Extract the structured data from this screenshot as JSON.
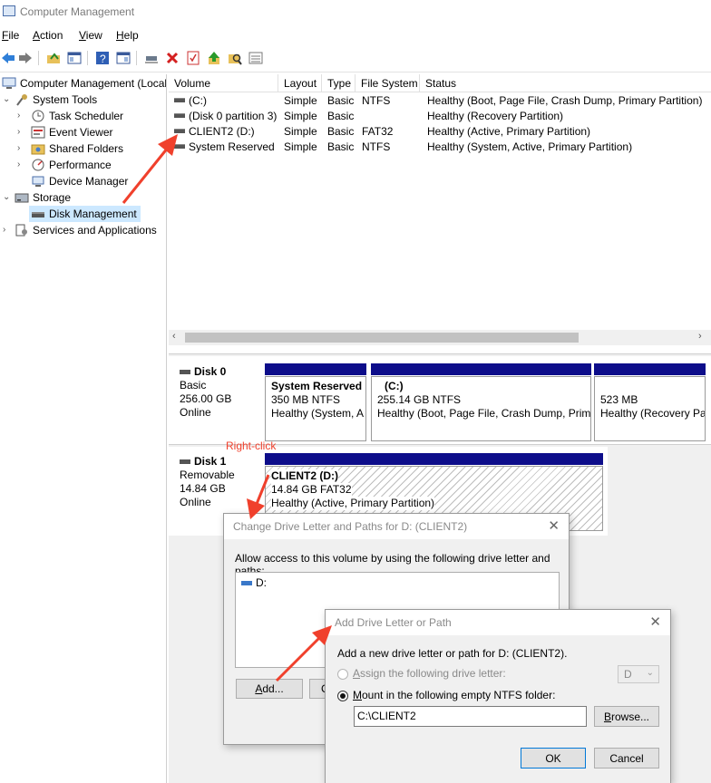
{
  "window": {
    "title": "Computer Management"
  },
  "menu": [
    {
      "label": "File",
      "key": "F",
      "rest": "ile"
    },
    {
      "label": "Action",
      "key": "A",
      "rest": "ction"
    },
    {
      "label": "View",
      "key": "V",
      "rest": "iew"
    },
    {
      "label": "Help",
      "key": "H",
      "rest": "elp"
    }
  ],
  "tree": {
    "root": "Computer Management (Local",
    "system_tools": "System Tools",
    "task_scheduler": "Task Scheduler",
    "event_viewer": "Event Viewer",
    "shared_folders": "Shared Folders",
    "performance": "Performance",
    "device_manager": "Device Manager",
    "storage": "Storage",
    "disk_management": "Disk Management",
    "services": "Services and Applications"
  },
  "list": {
    "columns": [
      "Volume",
      "Layout",
      "Type",
      "File System",
      "Status"
    ],
    "rows": [
      {
        "volume": "(C:)",
        "layout": "Simple",
        "type": "Basic",
        "fs": "NTFS",
        "status": "Healthy (Boot, Page File, Crash Dump, Primary Partition)"
      },
      {
        "volume": "(Disk 0 partition 3)",
        "layout": "Simple",
        "type": "Basic",
        "fs": "",
        "status": "Healthy (Recovery Partition)"
      },
      {
        "volume": "CLIENT2 (D:)",
        "layout": "Simple",
        "type": "Basic",
        "fs": "FAT32",
        "status": "Healthy (Active, Primary Partition)"
      },
      {
        "volume": "System Reserved",
        "layout": "Simple",
        "type": "Basic",
        "fs": "NTFS",
        "status": "Healthy (System, Active, Primary Partition)"
      }
    ]
  },
  "disk0": {
    "name": "Disk 0",
    "kind": "Basic",
    "size": "256.00 GB",
    "state": "Online",
    "p1": {
      "name": "System Reserved",
      "size": "350 MB NTFS",
      "status": "Healthy (System, A"
    },
    "p2": {
      "name": "(C:)",
      "size": "255.14 GB NTFS",
      "status": "Healthy (Boot, Page File, Crash Dump, Prima"
    },
    "p3": {
      "size": "523 MB",
      "status": "Healthy (Recovery Pa"
    }
  },
  "disk1": {
    "name": "Disk 1",
    "kind": "Removable",
    "size": "14.84 GB",
    "state": "Online",
    "p1": {
      "name": "CLIENT2  (D:)",
      "size": "14.84 GB FAT32",
      "status": "Healthy (Active, Primary Partition)"
    }
  },
  "annotation": {
    "right_click": "Right-click"
  },
  "dialog1": {
    "title": "Change Drive Letter and Paths for D: (CLIENT2)",
    "instruction": "Allow access to this volume by using the following drive letter and paths:",
    "entry": "D:",
    "add_key": "A",
    "add_rest": "dd...",
    "change_first": "C"
  },
  "dialog2": {
    "title": "Add Drive Letter or Path",
    "instruction": "Add a new drive letter or path for D: (CLIENT2).",
    "opt_assign_key": "A",
    "opt_assign_rest": "ssign the following drive letter:",
    "drive_letter": "D",
    "opt_mount_key": "M",
    "opt_mount_rest": "ount in the following empty NTFS folder:",
    "folder_path": "C:\\CLIENT2",
    "browse_key": "B",
    "browse_rest": "rowse...",
    "ok": "OK",
    "cancel": "Cancel"
  },
  "colors": {
    "accent_arrow": "#f0402c",
    "partition_bar": "#0d0d8a"
  }
}
